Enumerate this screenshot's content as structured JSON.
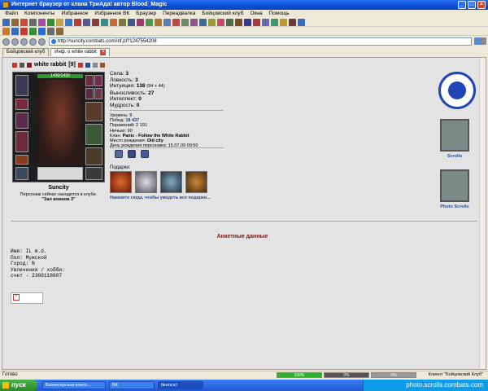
{
  "window": {
    "title": "Интернет браузер от клана ТриАда! автор Blood_Magic"
  },
  "menu": [
    "Файл",
    "Компоненты",
    "Избранное",
    "Избранное ВК",
    "Браузер",
    "Переадвалка",
    "Бойцовский клуб",
    "Окна",
    "Помощь"
  ],
  "address": {
    "url": "http://suncity.combats.com/inf.pl?1247554208"
  },
  "tabs": [
    {
      "label": "Бойцовский клуб"
    },
    {
      "label": "Инф. о white rabbit"
    }
  ],
  "character": {
    "name": "white rabbit",
    "level": "[9]",
    "hp": "1430/1430",
    "city": "Suncity",
    "location_text": "Персонаж сейчас находится в клубе.",
    "location_room": "\"Зал воинов 3\""
  },
  "stats": [
    {
      "label": "Сила:",
      "value": "3",
      "extra": ""
    },
    {
      "label": "Ловкость:",
      "value": "3",
      "extra": ""
    },
    {
      "label": "Интуиция:",
      "value": "138",
      "extra": "(94 + 44)"
    },
    {
      "label": "Выносливость:",
      "value": "27",
      "extra": ""
    },
    {
      "label": "Интеллект:",
      "value": "0",
      "extra": ""
    },
    {
      "label": "Мудрость:",
      "value": "0",
      "extra": ""
    }
  ],
  "info": [
    {
      "label": "Уровень:",
      "value": "9"
    },
    {
      "label": "Побед:",
      "value": "18 437"
    },
    {
      "label": "Поражений:",
      "value": "2 191"
    },
    {
      "label": "Ничьих:",
      "value": "90"
    },
    {
      "label": "Клан:",
      "value": "Panic - Follow the White Rabbit"
    },
    {
      "label": "Место рождения:",
      "value": "Old city"
    },
    {
      "label": "День рождения персонажа:",
      "value": "15.07.09 00:50"
    }
  ],
  "gifts": {
    "title": "Подарки:",
    "link": "Нажмите сюда, чтобы увидеть все подарки..."
  },
  "side_links": {
    "scrolls": "Scrolls",
    "photo_scrolls": "Photo Scrolls"
  },
  "anketa": {
    "title": "Анкетные данные",
    "lines": [
      "Имя: IL m.d.",
      "Пол: Мужской",
      "Город: N",
      "Увлечения / хобби:",
      "счет - 2360118607"
    ]
  },
  "statusbar": {
    "status": "Готово",
    "progress_1": "100%",
    "progress_2": "0%",
    "progress_3": "0%",
    "client": "Клиент \"Бойцовский Клуб\""
  },
  "taskbar": {
    "start": "пуск",
    "tasks": [
      "Бизнесерская конто...",
      "ВК",
      "bkencicl"
    ],
    "tray": "photo.scrolls.combats.com"
  },
  "colors": {
    "accent": "#2b4a9a",
    "anketa_title": "#7b1a1a",
    "taskbar": "#2459d4",
    "start": "#2d8b2c"
  }
}
